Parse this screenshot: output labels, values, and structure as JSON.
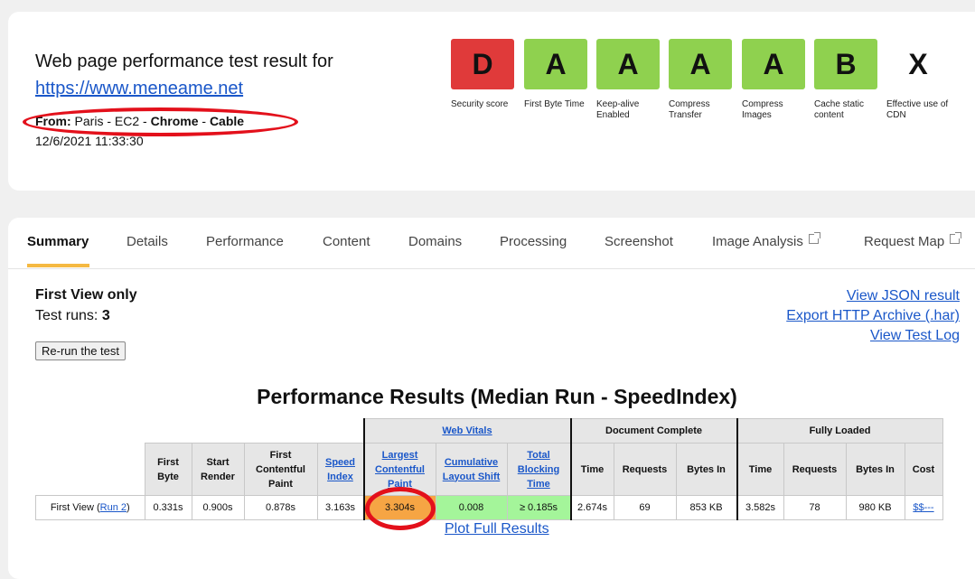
{
  "header": {
    "title": "Web page performance test result for",
    "url": "https://www.meneame.net",
    "from_label": "From:",
    "from_location": " Paris - EC2 - ",
    "browser": "Chrome",
    "separator": " - ",
    "connection": "Cable",
    "date": "12/6/2021 11:33:30"
  },
  "grades": [
    {
      "grade": "D",
      "label": "Security score",
      "color": "#e03a3a"
    },
    {
      "grade": "A",
      "label": "First Byte Time",
      "color": "#8fd14f"
    },
    {
      "grade": "A",
      "label": "Keep-alive Enabled",
      "color": "#8fd14f"
    },
    {
      "grade": "A",
      "label": "Compress Transfer",
      "color": "#8fd14f"
    },
    {
      "grade": "A",
      "label": "Compress Images",
      "color": "#8fd14f"
    },
    {
      "grade": "B",
      "label": "Cache static content",
      "color": "#8fd14f"
    },
    {
      "grade": "X",
      "label": "Effective use of CDN",
      "color": "#ffffff"
    }
  ],
  "tabs": [
    "Summary",
    "Details",
    "Performance",
    "Content",
    "Domains",
    "Processing",
    "Screenshot",
    "Image Analysis",
    "Request Map"
  ],
  "summary": {
    "view_title": "First View only",
    "runs_label": "Test runs: ",
    "runs_value": "3",
    "rerun_button": "Re-run the test",
    "links": [
      "View JSON result",
      "Export HTTP Archive (.har)",
      "View Test Log"
    ]
  },
  "results": {
    "title": "Performance Results (Median Run - SpeedIndex)",
    "groups": {
      "web_vitals": "Web Vitals",
      "document_complete": "Document Complete",
      "fully_loaded": "Fully Loaded"
    },
    "columns": {
      "first_byte": "First Byte",
      "start_render": "Start Render",
      "fcp": "First Contentful Paint",
      "speed_index": "Speed Index",
      "lcp": "Largest Contentful Paint",
      "cls": "Cumulative Layout Shift",
      "tbt": "Total Blocking Time",
      "time": "Time",
      "requests": "Requests",
      "bytes_in": "Bytes In",
      "cost": "Cost"
    },
    "row": {
      "label": "First View (",
      "run_link": "Run 2",
      "label_end": ")",
      "first_byte": "0.331s",
      "start_render": "0.900s",
      "fcp": "0.878s",
      "speed_index": "3.163s",
      "lcp": "3.304s",
      "cls": "0.008",
      "tbt": "≥ 0.185s",
      "doc_time": "2.674s",
      "doc_requests": "69",
      "doc_bytes": "853 KB",
      "full_time": "3.582s",
      "full_requests": "78",
      "full_bytes": "980 KB",
      "cost": "$$---"
    },
    "plot_link": "Plot Full Results"
  }
}
